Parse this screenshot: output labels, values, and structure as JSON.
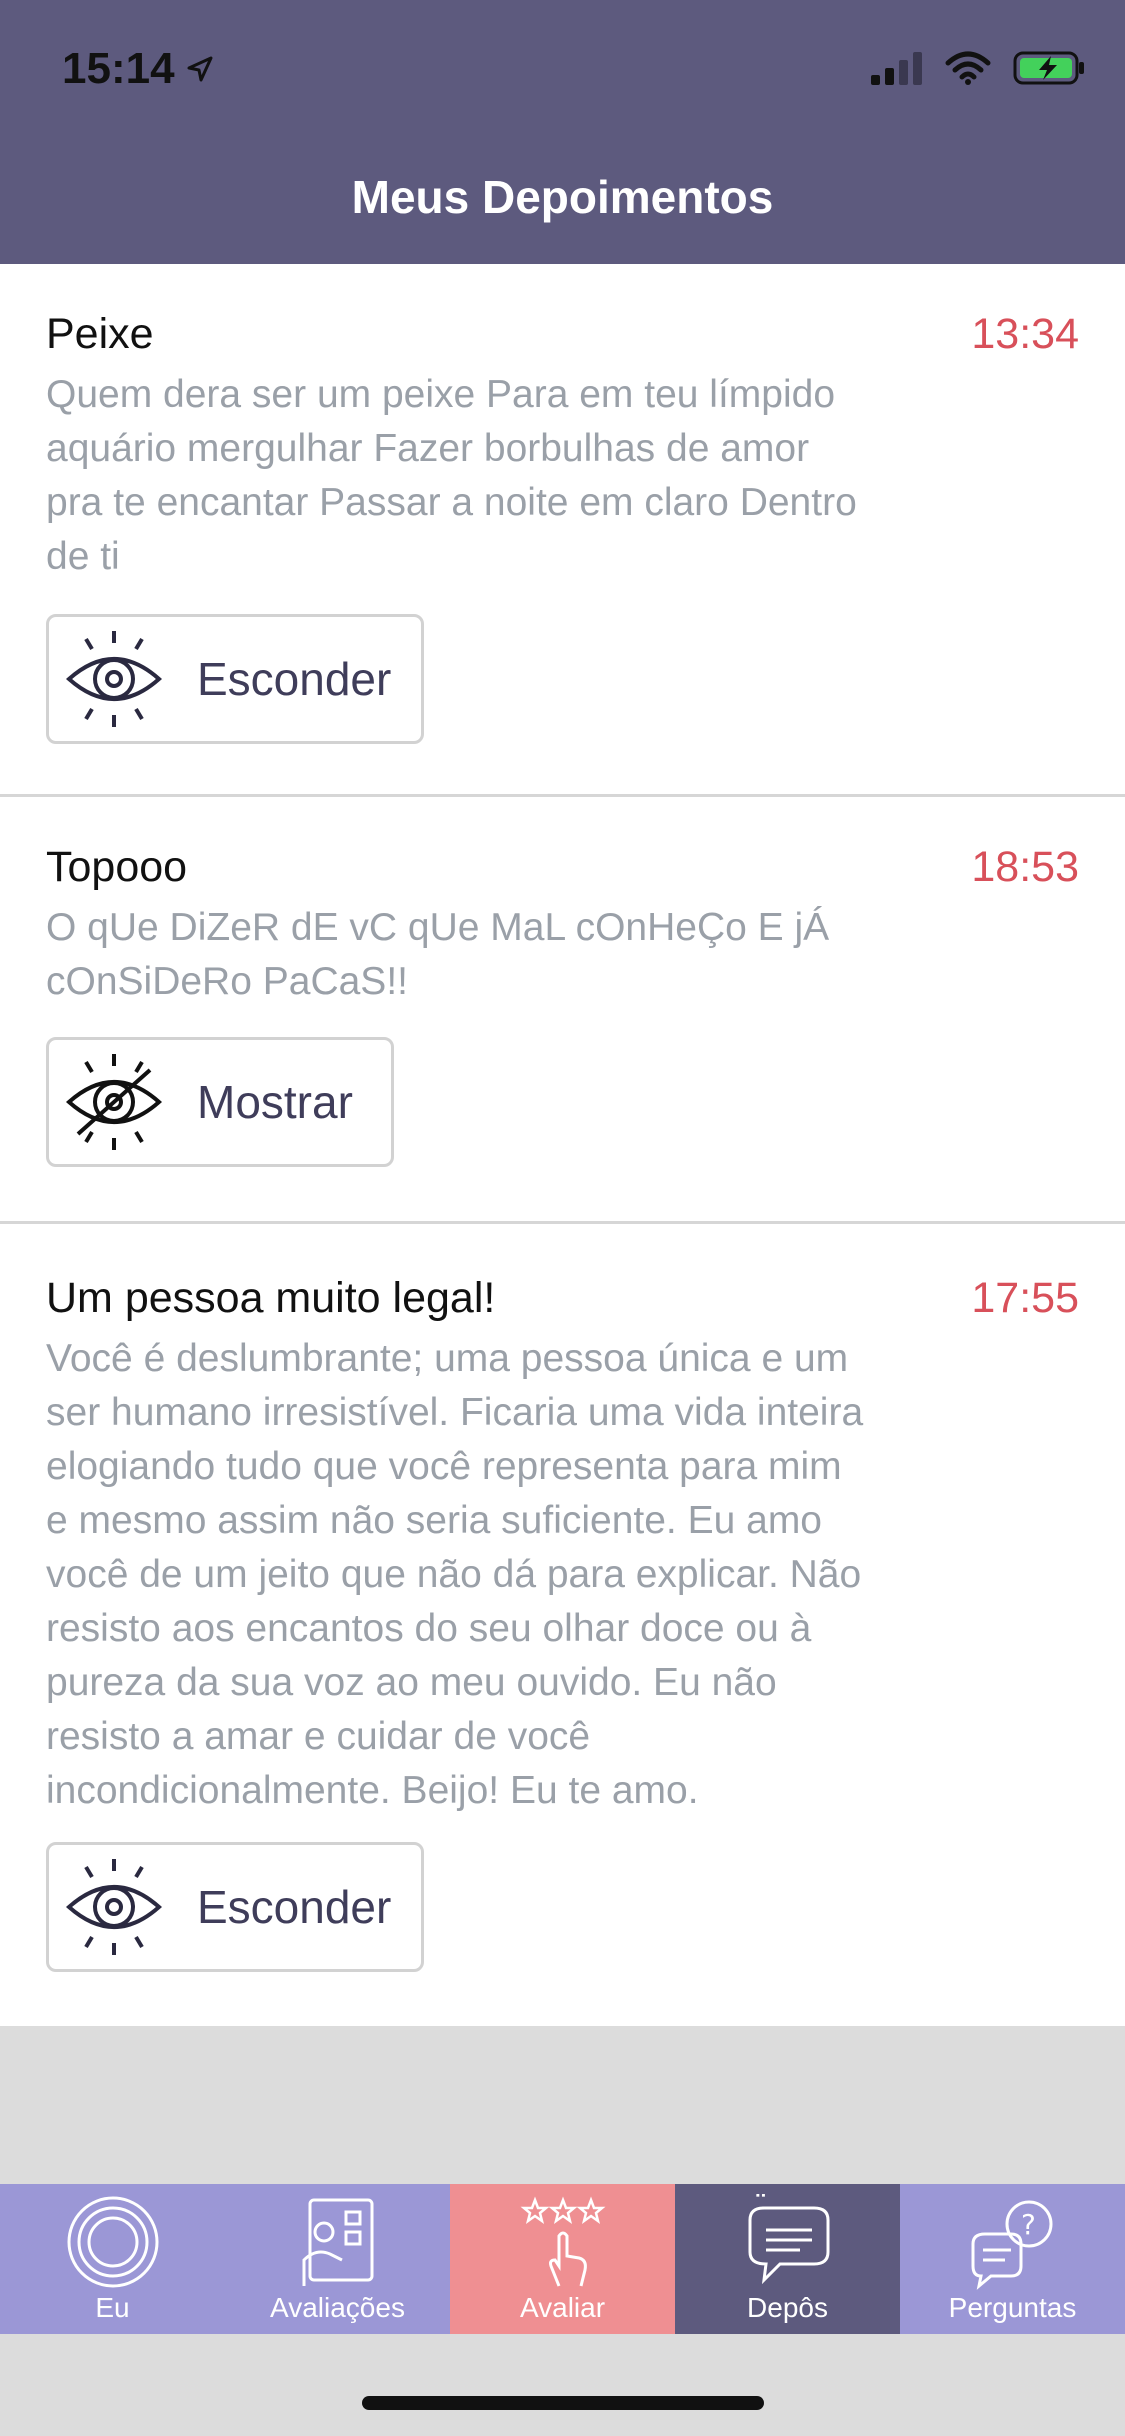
{
  "status": {
    "time": "15:14"
  },
  "header": {
    "title": "Meus Depoimentos"
  },
  "testimonials": [
    {
      "title": "Peixe",
      "time": "13:34",
      "lines": [
        "Quem dera ser um peixe Para em teu límpido",
        "aquário mergulhar Fazer borbulhas de amor",
        "pra te encantar Passar a noite em claro Dentro",
        "de ti"
      ],
      "button": "Esconder"
    },
    {
      "title": "Topooo",
      "time": "18:53",
      "lines": [
        "O qUe DiZeR dE vC qUe MaL cOnHeÇo E jÁ",
        "cOnSiDeRo PaCaS!!"
      ],
      "button": "Mostrar"
    },
    {
      "title": "Um pessoa muito legal!",
      "time": "17:55",
      "lines": [
        "Você é deslumbrante; uma pessoa única e um",
        "ser humano irresistível. Ficaria uma vida inteira",
        "elogiando tudo que você representa para mim",
        "e mesmo assim não seria suficiente. Eu amo",
        "você de um jeito que não dá para explicar. Não",
        "resisto aos encantos do seu olhar doce ou à",
        "pureza da sua voz ao meu ouvido. Eu não",
        "resisto a amar e cuidar de você",
        "incondicionalmente. Beijo! Eu te amo."
      ],
      "button": "Esconder"
    }
  ],
  "tabs": [
    {
      "label": "Eu",
      "icon": "target-icon",
      "color": "#9b97d6"
    },
    {
      "label": "Avaliações",
      "icon": "ratings-icon",
      "color": "#9b97d6"
    },
    {
      "label": "Avaliar",
      "icon": "rate-stars-icon",
      "color": "#ef8f92"
    },
    {
      "label": "Depôs",
      "icon": "quote-bubble-icon",
      "color": "#5d5a7e"
    },
    {
      "label": "Perguntas",
      "icon": "question-bubble-icon",
      "color": "#9b97d6"
    }
  ],
  "colors": {
    "header": "#5d5a7e",
    "accent_time": "#d8505a",
    "tab_default": "#9b97d6",
    "tab_avaliar": "#ef8f92",
    "tab_active": "#5d5a7e"
  }
}
